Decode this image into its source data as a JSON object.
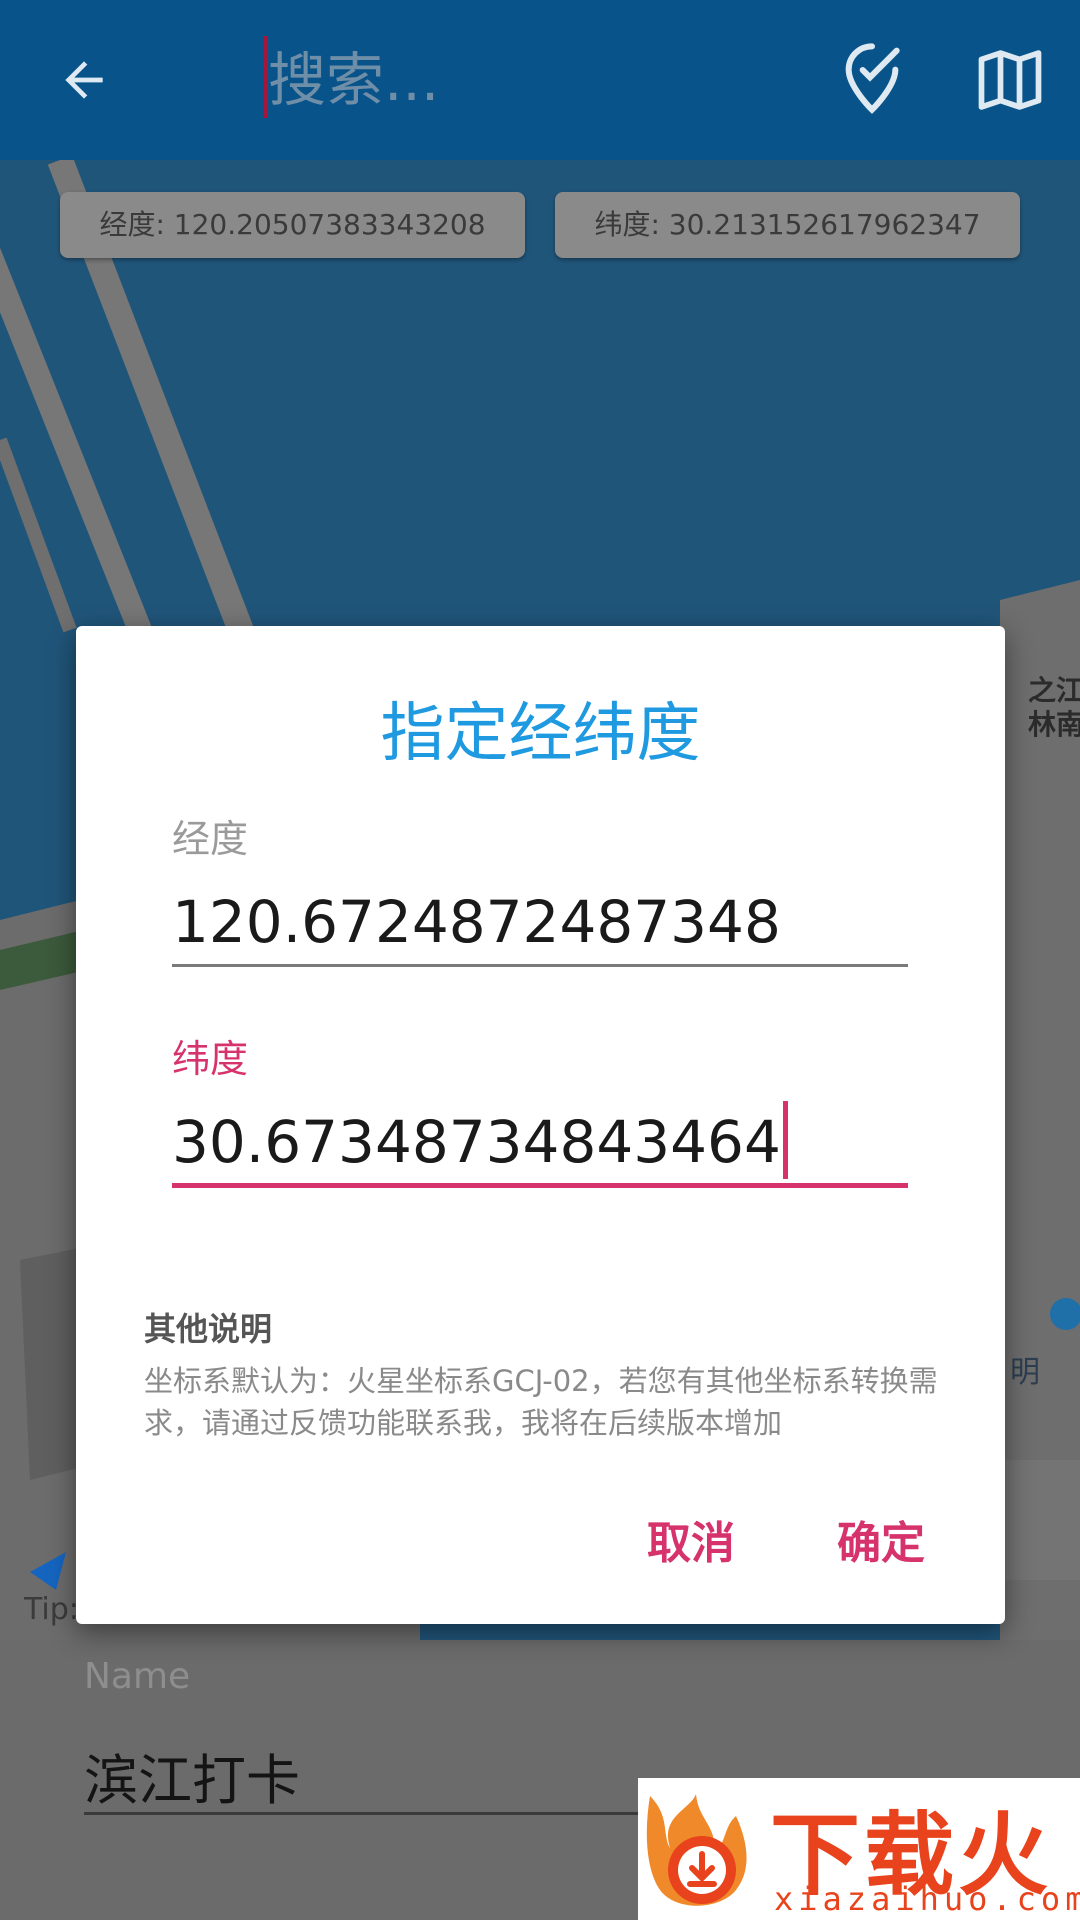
{
  "appbar": {
    "search_placeholder": "搜索...",
    "icons": [
      "arrow-back-icon",
      "location-edit-icon",
      "map-icon"
    ]
  },
  "chips": {
    "longitude_label": "经度:",
    "longitude_value": "120.20507383343208",
    "latitude_label": "纬度:",
    "latitude_value": "30.213152617962347"
  },
  "map": {
    "place_label_line1": "之江",
    "place_label_line2": "林南",
    "tip_text": "Tip:",
    "overlay_text": "明"
  },
  "dialog": {
    "title": "指定经纬度",
    "longitude_label": "经度",
    "longitude_value": "120.6724872487348",
    "latitude_label": "纬度",
    "latitude_value": "30.67348734843464",
    "note_title": "其他说明",
    "note_body": "坐标系默认为：火星坐标系GCJ-02，若您有其他坐标系转换需求，请通过反馈功能联系我，我将在后续版本增加",
    "cancel_label": "取消",
    "ok_label": "确定"
  },
  "form": {
    "name_label": "Name",
    "name_value": "滨江打卡"
  },
  "watermark": {
    "title": "下载火",
    "domain": "xiazaihuo.com"
  },
  "colors": {
    "appbar": "#08548a",
    "dialog_title": "#1f9ae0",
    "accent": "#d6336c",
    "watermark": "#e8431c"
  }
}
